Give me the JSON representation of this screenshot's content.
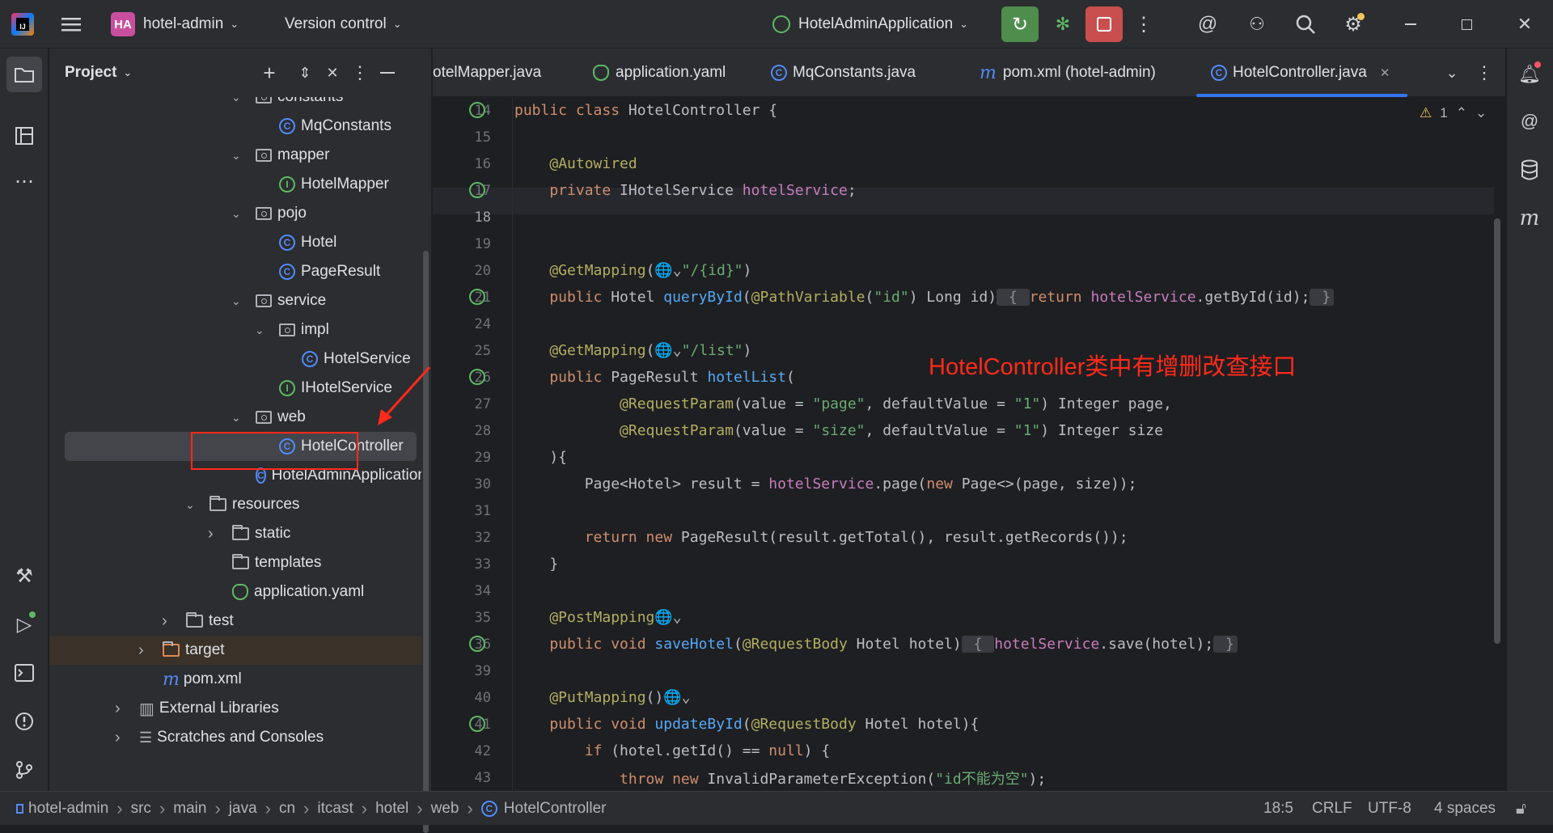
{
  "titlebar": {
    "project_badge": "HA",
    "project_name": "hotel-admin",
    "version_control": "Version control",
    "run_config": "HotelAdminApplication"
  },
  "project_panel": {
    "title": "Project",
    "tree": [
      {
        "label": "constants",
        "kind": "package",
        "expanded": true
      },
      {
        "label": "MqConstants",
        "kind": "class"
      },
      {
        "label": "mapper",
        "kind": "package",
        "expanded": true
      },
      {
        "label": "HotelMapper",
        "kind": "interface"
      },
      {
        "label": "pojo",
        "kind": "package",
        "expanded": true
      },
      {
        "label": "Hotel",
        "kind": "class"
      },
      {
        "label": "PageResult",
        "kind": "class"
      },
      {
        "label": "service",
        "kind": "package",
        "expanded": true
      },
      {
        "label": "impl",
        "kind": "package",
        "expanded": true
      },
      {
        "label": "HotelService",
        "kind": "class"
      },
      {
        "label": "IHotelService",
        "kind": "interface"
      },
      {
        "label": "web",
        "kind": "package",
        "expanded": true
      },
      {
        "label": "HotelController",
        "kind": "class",
        "selected": true
      },
      {
        "label": "HotelAdminApplication",
        "kind": "spring-class"
      },
      {
        "label": "resources",
        "kind": "folder",
        "expanded": true
      },
      {
        "label": "static",
        "kind": "folder",
        "expanded": false
      },
      {
        "label": "templates",
        "kind": "folder"
      },
      {
        "label": "application.yaml",
        "kind": "yaml"
      },
      {
        "label": "test",
        "kind": "folder",
        "expanded": false
      },
      {
        "label": "target",
        "kind": "folder-orange",
        "expanded": false
      },
      {
        "label": "pom.xml",
        "kind": "maven"
      },
      {
        "label": "External Libraries",
        "kind": "library",
        "expanded": false
      },
      {
        "label": "Scratches and Consoles",
        "kind": "scratches",
        "expanded": false
      }
    ]
  },
  "editor": {
    "tabs": [
      {
        "label": "otelMapper.java"
      },
      {
        "label": "application.yaml"
      },
      {
        "label": "MqConstants.java"
      },
      {
        "label": "pom.xml (hotel-admin)"
      },
      {
        "label": "HotelController.java",
        "active": true
      }
    ],
    "warnings": "1",
    "lines": [
      {
        "n": "14",
        "tokens": [
          [
            "kw",
            "public class "
          ],
          [
            "ty",
            "HotelController {"
          ]
        ]
      },
      {
        "n": "15",
        "tokens": []
      },
      {
        "n": "16",
        "tokens": [
          [
            "ty",
            "    "
          ],
          [
            "an",
            "@Autowired"
          ]
        ]
      },
      {
        "n": "17",
        "tokens": [
          [
            "kw",
            "    private "
          ],
          [
            "ty",
            "IHotelService "
          ],
          [
            "fd",
            "hotelService"
          ],
          [
            "ty",
            ";"
          ]
        ]
      },
      {
        "n": "18",
        "tokens": []
      },
      {
        "n": "19",
        "tokens": []
      },
      {
        "n": "20",
        "tokens": [
          [
            "an",
            "    @GetMapping"
          ],
          [
            "ty",
            "(🌐⌄"
          ],
          [
            "st",
            "\"/{id}\""
          ],
          [
            "ty",
            ")"
          ]
        ]
      },
      {
        "n": "21",
        "tokens": [
          [
            "kw",
            "    public "
          ],
          [
            "ty",
            "Hotel "
          ],
          [
            "fn",
            "queryById"
          ],
          [
            "ty",
            "("
          ],
          [
            "an",
            "@PathVariable"
          ],
          [
            "ty",
            "("
          ],
          [
            "st",
            "\"id\""
          ],
          [
            "ty",
            ") Long id)"
          ],
          [
            "fold",
            " { "
          ],
          [
            "kw",
            "return "
          ],
          [
            "fd",
            "hotelService"
          ],
          [
            "ty",
            ".getById(id);"
          ],
          [
            "fold",
            " }"
          ]
        ]
      },
      {
        "n": "24",
        "tokens": []
      },
      {
        "n": "25",
        "tokens": [
          [
            "an",
            "    @GetMapping"
          ],
          [
            "ty",
            "(🌐⌄"
          ],
          [
            "st",
            "\"/list\""
          ],
          [
            "ty",
            ")"
          ]
        ]
      },
      {
        "n": "26",
        "tokens": [
          [
            "kw",
            "    public "
          ],
          [
            "ty",
            "PageResult "
          ],
          [
            "fn",
            "hotelList"
          ],
          [
            "ty",
            "("
          ]
        ]
      },
      {
        "n": "27",
        "tokens": [
          [
            "an",
            "            @RequestParam"
          ],
          [
            "ty",
            "(value = "
          ],
          [
            "st",
            "\"page\""
          ],
          [
            "ty",
            ", defaultValue = "
          ],
          [
            "st",
            "\"1\""
          ],
          [
            "ty",
            ") Integer page,"
          ]
        ]
      },
      {
        "n": "28",
        "tokens": [
          [
            "an",
            "            @RequestParam"
          ],
          [
            "ty",
            "(value = "
          ],
          [
            "st",
            "\"size\""
          ],
          [
            "ty",
            ", defaultValue = "
          ],
          [
            "st",
            "\"1\""
          ],
          [
            "ty",
            ") Integer size"
          ]
        ]
      },
      {
        "n": "29",
        "tokens": [
          [
            "ty",
            "    ){"
          ]
        ]
      },
      {
        "n": "30",
        "tokens": [
          [
            "ty",
            "        Page<Hotel> result = "
          ],
          [
            "fd",
            "hotelService"
          ],
          [
            "ty",
            ".page("
          ],
          [
            "kw",
            "new "
          ],
          [
            "ty",
            "Page<>(page, size));"
          ]
        ]
      },
      {
        "n": "31",
        "tokens": []
      },
      {
        "n": "32",
        "tokens": [
          [
            "kw",
            "        return new "
          ],
          [
            "ty",
            "PageResult(result.getTotal(), result.getRecords());"
          ]
        ]
      },
      {
        "n": "33",
        "tokens": [
          [
            "ty",
            "    }"
          ]
        ]
      },
      {
        "n": "34",
        "tokens": []
      },
      {
        "n": "35",
        "tokens": [
          [
            "an",
            "    @PostMapping"
          ],
          [
            "ty",
            "🌐⌄"
          ]
        ]
      },
      {
        "n": "36",
        "tokens": [
          [
            "kw",
            "    public void "
          ],
          [
            "fn",
            "saveHotel"
          ],
          [
            "ty",
            "("
          ],
          [
            "an",
            "@RequestBody "
          ],
          [
            "ty",
            "Hotel hotel)"
          ],
          [
            "fold",
            " { "
          ],
          [
            "fd",
            "hotelService"
          ],
          [
            "ty",
            ".save(hotel);"
          ],
          [
            "fold",
            " }"
          ]
        ]
      },
      {
        "n": "39",
        "tokens": []
      },
      {
        "n": "40",
        "tokens": [
          [
            "an",
            "    @PutMapping"
          ],
          [
            "ty",
            "()🌐⌄"
          ]
        ]
      },
      {
        "n": "41",
        "tokens": [
          [
            "kw",
            "    public void "
          ],
          [
            "fn",
            "updateById"
          ],
          [
            "ty",
            "("
          ],
          [
            "an",
            "@RequestBody "
          ],
          [
            "ty",
            "Hotel hotel){"
          ]
        ]
      },
      {
        "n": "42",
        "tokens": [
          [
            "kw",
            "        if "
          ],
          [
            "ty",
            "(hotel.getId() == "
          ],
          [
            "kw",
            "null"
          ],
          [
            "ty",
            ") {"
          ]
        ]
      },
      {
        "n": "43",
        "tokens": [
          [
            "kw",
            "            throw new "
          ],
          [
            "ty",
            "InvalidParameterException("
          ],
          [
            "st",
            "\"id不能为空\""
          ],
          [
            "ty",
            ");"
          ]
        ]
      }
    ]
  },
  "annotation": "HotelController类中有增删改查接口",
  "statusbar": {
    "breadcrumb": [
      "hotel-admin",
      "src",
      "main",
      "java",
      "cn",
      "itcast",
      "hotel",
      "web",
      "HotelController"
    ],
    "position": "18:5",
    "line_sep": "CRLF",
    "encoding": "UTF-8",
    "indent": "4 spaces"
  }
}
